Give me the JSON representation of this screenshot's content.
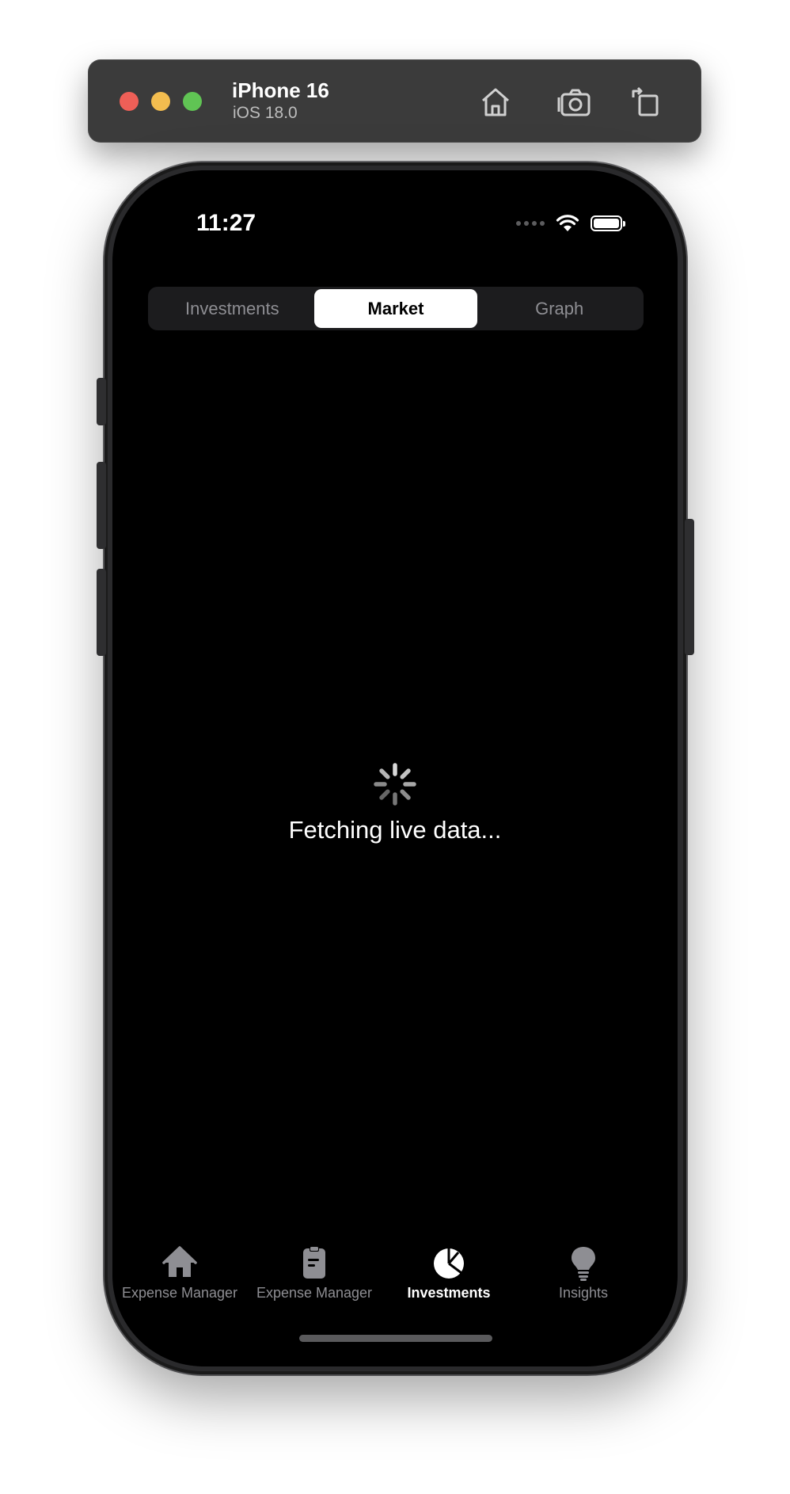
{
  "simulator": {
    "device_name": "iPhone 16",
    "os_version": "iOS 18.0",
    "toolbar_icons": [
      "home-icon",
      "screenshot-icon",
      "rotate-icon"
    ]
  },
  "status_bar": {
    "time": "11:27",
    "icons": [
      "signal-icon",
      "wifi-icon",
      "battery-icon"
    ]
  },
  "segmented_control": {
    "segments": [
      "Investments",
      "Market",
      "Graph"
    ],
    "selected": "Market"
  },
  "loading": {
    "text": "Fetching live data..."
  },
  "tab_bar": {
    "items": [
      {
        "label": "Expense Manager",
        "icon": "house-icon"
      },
      {
        "label": "Expense Manager",
        "icon": "clipboard-icon"
      },
      {
        "label": "Investments",
        "icon": "pie-chart-icon"
      },
      {
        "label": "Insights",
        "icon": "lightbulb-icon"
      }
    ],
    "selected": "Investments"
  },
  "colors": {
    "background": "#000000",
    "segment_active_bg": "#ffffff",
    "inactive_text": "#8e8e93",
    "active_text": "#ffffff"
  }
}
